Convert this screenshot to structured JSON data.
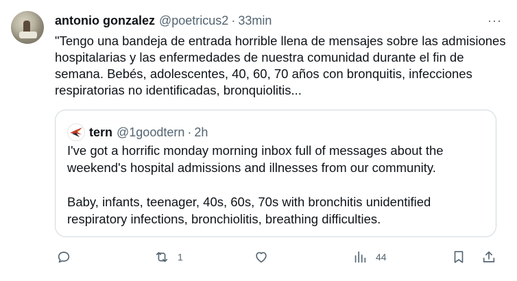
{
  "tweet": {
    "author_name": "antonio gonzalez",
    "author_handle": "@poetricus2",
    "separator": "·",
    "time": "33min",
    "more_label": "···",
    "text": "\"Tengo una bandeja de entrada horrible llena de mensajes sobre las admisiones hospitalarias y las enfermedades de nuestra comunidad durante el fin de semana. Bebés, adolescentes, 40, 60, 70 años con bronquitis, infecciones respiratorias no identificadas, bronquiolitis...",
    "quote": {
      "author_name": "tern",
      "author_handle": "@1goodtern",
      "separator": "·",
      "time": "2h",
      "text": "I've got a horrific monday morning inbox full of messages about the weekend's hospital admissions and illnesses from our community.\n\nBaby, infants, teenager, 40s, 60s, 70s with bronchitis unidentified respiratory infections, bronchiolitis, breathing difficulties."
    },
    "actions": {
      "reply": {
        "icon": "reply-icon",
        "count": ""
      },
      "retweet": {
        "icon": "retweet-icon",
        "count": "1"
      },
      "like": {
        "icon": "heart-icon",
        "count": ""
      },
      "views": {
        "icon": "views-icon",
        "count": "44"
      },
      "bookmark": {
        "icon": "bookmark-icon",
        "count": ""
      },
      "share": {
        "icon": "share-icon",
        "count": ""
      }
    }
  }
}
